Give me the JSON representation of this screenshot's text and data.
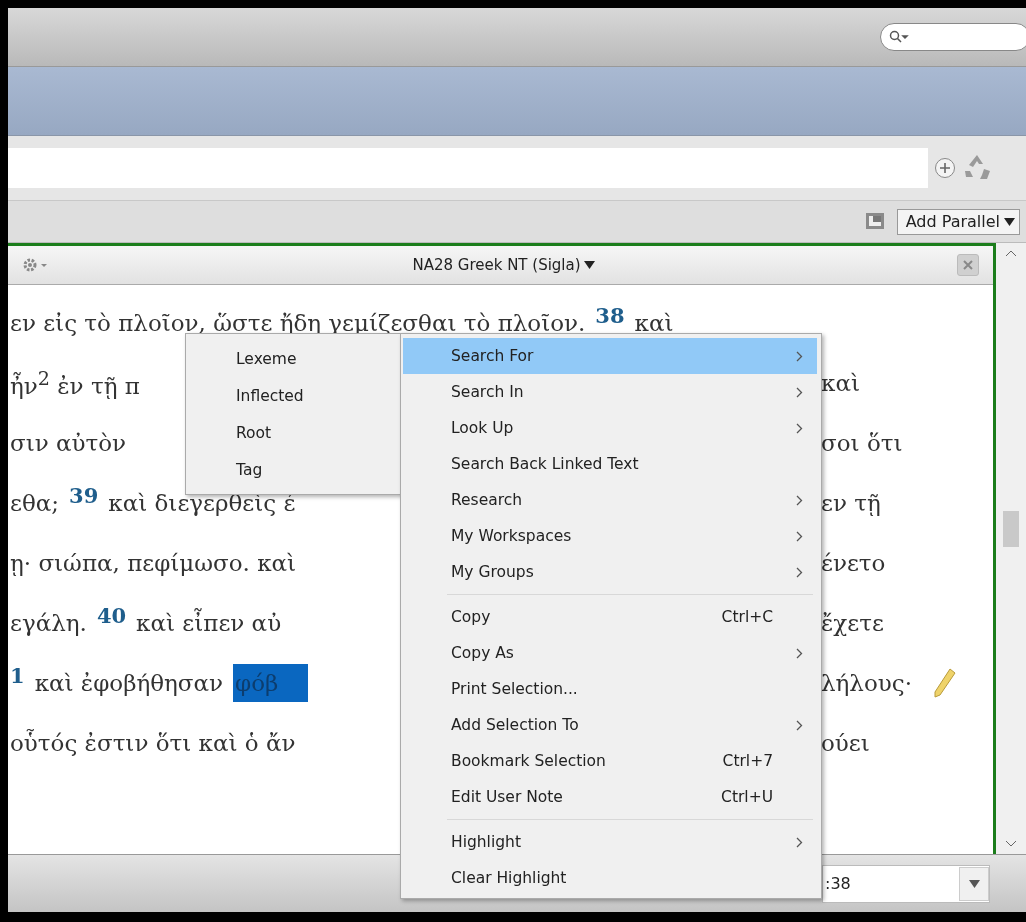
{
  "add_parallel": {
    "label": "Add Parallel"
  },
  "panel": {
    "title": "NA28 Greek NT (Sigla)",
    "lines": [
      {
        "left": [
          {
            "kind": "text",
            "text": "εν εἰς τὸ πλοῖον, ὥστε ἤδη γεμίζεσθαι τὸ πλοῖον."
          },
          {
            "kind": "verse",
            "text": "38"
          },
          {
            "kind": "text",
            "text": "καὶ"
          }
        ]
      },
      {
        "left": [
          {
            "kind": "text",
            "text": "ἦν$^{2}$ ἐν τῇ π"
          }
        ],
        "right": [
          {
            "kind": "text",
            "text": "καὶ"
          }
        ]
      },
      {
        "left": [
          {
            "kind": "text",
            "text": "σιν αὐτὸν"
          }
        ],
        "right": [
          {
            "kind": "text",
            "text": "σοι ὅτι"
          }
        ]
      },
      {
        "left": [
          {
            "kind": "text",
            "text": "εθα;"
          },
          {
            "kind": "verse",
            "text": "39"
          },
          {
            "kind": "text",
            "text": "καὶ διεγερθεὶς ἐ"
          }
        ],
        "right": [
          {
            "kind": "text",
            "text": "εν τῇ"
          }
        ]
      },
      {
        "left": [
          {
            "kind": "text",
            "text": "ῃ· σιώπα, πεφίμωσο. καὶ"
          }
        ],
        "right": [
          {
            "kind": "text",
            "text": "ένετο"
          }
        ]
      },
      {
        "left": [
          {
            "kind": "text",
            "text": "εγάλη."
          },
          {
            "kind": "verse",
            "text": "40"
          },
          {
            "kind": "text",
            "text": "καὶ εἶπεν αὐ"
          }
        ],
        "right": [
          {
            "kind": "text",
            "text": "ἔχετε"
          }
        ]
      },
      {
        "left": [
          {
            "kind": "verse",
            "text": "1"
          },
          {
            "kind": "text",
            "text": "καὶ ἐφοβήθησαν"
          },
          {
            "kind": "selection",
            "text": "φόβ"
          }
        ],
        "right": [
          {
            "kind": "text",
            "text": "λήλους·"
          },
          {
            "kind": "pencil"
          }
        ]
      },
      {
        "left": [
          {
            "kind": "text",
            "text": "οὗτός ἐστιν ὅτι καὶ ὁ ἄν"
          }
        ],
        "right": [
          {
            "kind": "text",
            "text": "ούει"
          }
        ]
      }
    ]
  },
  "reference_field": {
    "value": ":38"
  },
  "submenu": {
    "items": [
      {
        "label": "Lexeme",
        "selected": false
      },
      {
        "label": "Inflected",
        "selected": false
      },
      {
        "label": "Root",
        "selected": false
      },
      {
        "label": "Tag",
        "selected": false
      }
    ]
  },
  "context_menu": {
    "items": [
      {
        "kind": "item",
        "label": "Search For",
        "has_submenu": true,
        "selected": true
      },
      {
        "kind": "item",
        "label": "Search In",
        "has_submenu": true,
        "selected": false
      },
      {
        "kind": "item",
        "label": "Look Up",
        "has_submenu": true,
        "selected": false
      },
      {
        "kind": "item",
        "label": "Search Back Linked Text",
        "has_submenu": false,
        "selected": false
      },
      {
        "kind": "item",
        "label": "Research",
        "has_submenu": true,
        "selected": false
      },
      {
        "kind": "item",
        "label": "My Workspaces",
        "has_submenu": true,
        "selected": false
      },
      {
        "kind": "item",
        "label": "My Groups",
        "has_submenu": true,
        "selected": false
      },
      {
        "kind": "separator"
      },
      {
        "kind": "item",
        "label": "Copy",
        "shortcut": "Ctrl+C",
        "has_submenu": false,
        "selected": false
      },
      {
        "kind": "item",
        "label": "Copy As",
        "has_submenu": true,
        "selected": false
      },
      {
        "kind": "item",
        "label": "Print Selection...",
        "has_submenu": false,
        "selected": false
      },
      {
        "kind": "item",
        "label": "Add Selection To",
        "has_submenu": true,
        "selected": false
      },
      {
        "kind": "item",
        "label": "Bookmark Selection",
        "shortcut": "Ctrl+7",
        "has_submenu": false,
        "selected": false
      },
      {
        "kind": "item",
        "label": "Edit User Note",
        "shortcut": "Ctrl+U",
        "has_submenu": false,
        "selected": false
      },
      {
        "kind": "separator"
      },
      {
        "kind": "item",
        "label": "Highlight",
        "has_submenu": true,
        "selected": false
      },
      {
        "kind": "item",
        "label": "Clear Highlight",
        "has_submenu": false,
        "selected": false
      }
    ]
  }
}
